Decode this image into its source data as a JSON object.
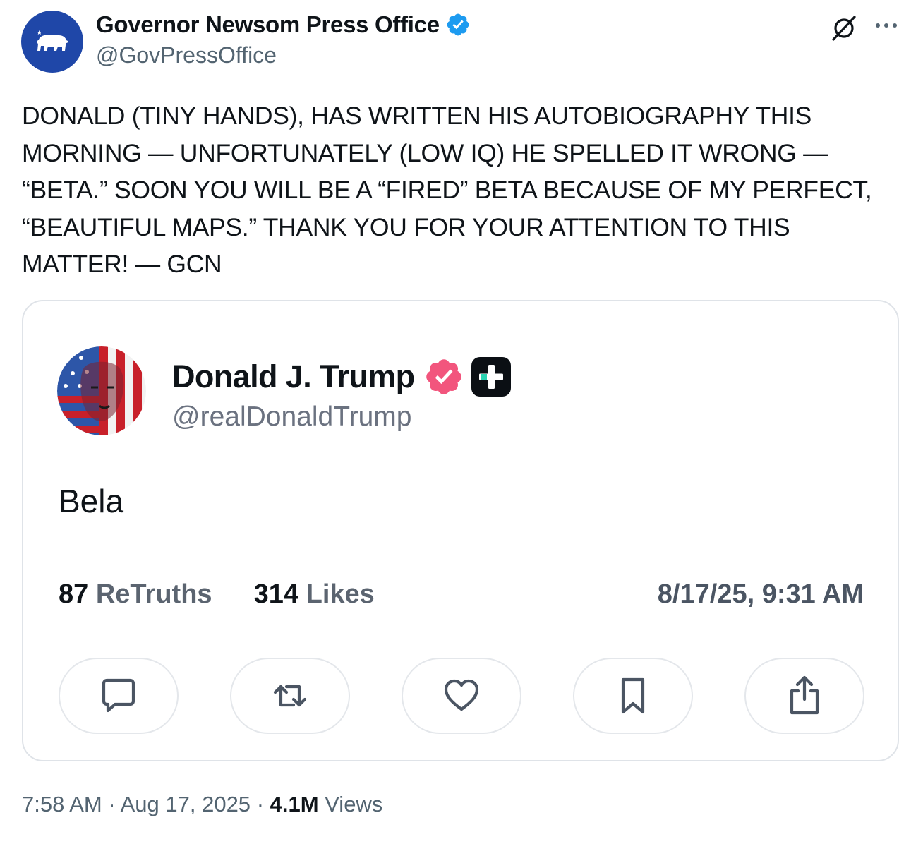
{
  "tweet": {
    "author_name": "Governor Newsom Press Office",
    "author_handle": "@GovPressOffice",
    "avatar_icon": "california-bear-icon",
    "verified_icon": "verified-badge-icon",
    "text": "DONALD (TINY HANDS), HAS WRITTEN HIS AUTOBIOGRAPHY THIS\nMORNING — UNFORTUNATELY (LOW IQ) HE SPELLED IT WRONG —\n“BETA.” SOON YOU WILL BE A “FIRED” BETA BECAUSE OF MY PERFECT,\n“BEAUTIFUL MAPS.” THANK YOU FOR YOUR ATTENTION TO THIS\nMATTER! — GCN",
    "time": "7:58 AM",
    "separator": "·",
    "date": "Aug 17, 2025",
    "views_count": "4.1M",
    "views_label": "Views"
  },
  "quote": {
    "author_name": "Donald J. Trump",
    "author_handle": "@realDonaldTrump",
    "body": "Bela",
    "retruths_count": "87",
    "retruths_label": "ReTruths",
    "likes_count": "314",
    "likes_label": "Likes",
    "timestamp": "8/17/25, 9:31 AM",
    "actions": [
      "reply-icon",
      "retruth-icon",
      "like-icon",
      "bookmark-icon",
      "share-icon"
    ]
  },
  "colors": {
    "accent_blue": "#1d9bf0",
    "truth_badge": "#f2557d",
    "text_primary": "#0f1419",
    "text_secondary": "#536471"
  }
}
